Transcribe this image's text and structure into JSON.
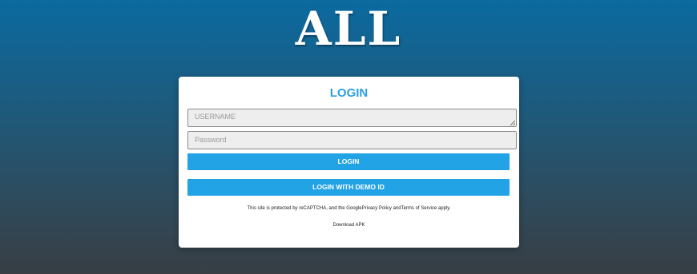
{
  "logo": {
    "text": "ALL"
  },
  "login": {
    "title": "LOGIN",
    "username_placeholder": "USERNAME",
    "password_placeholder": "Password",
    "login_button": "LOGIN",
    "demo_button": "LOGIN WITH DEMO ID",
    "recaptcha_notice": "This site is protected by reCAPTCHA, and the GooglePrivacy Policy andTerms of Service apply.",
    "download_link": "Download APK"
  },
  "colors": {
    "accent": "#22a3e6",
    "title": "#29a0e0",
    "bg_top": "#0b6aa0",
    "bg_bottom": "#383e44"
  }
}
